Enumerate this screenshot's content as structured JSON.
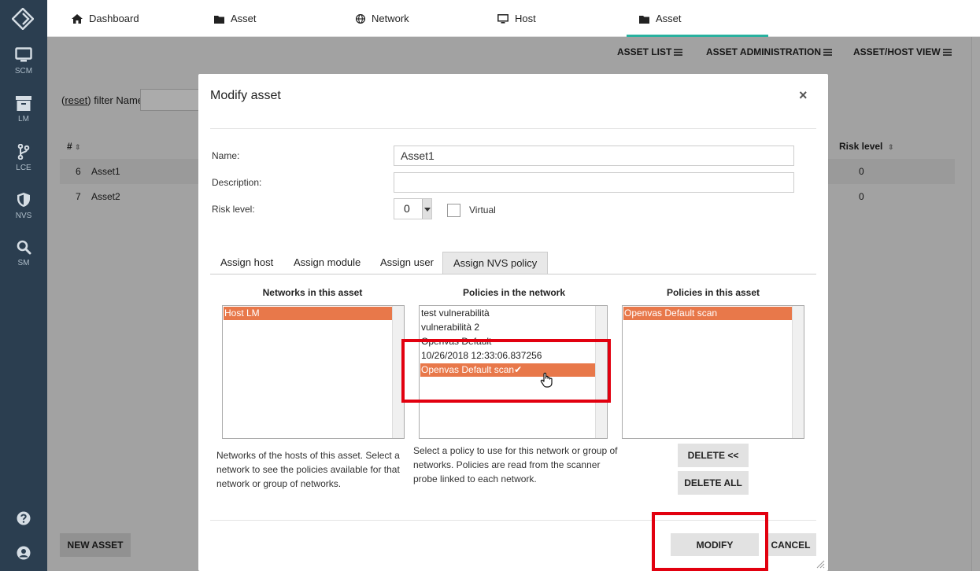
{
  "sidebar": {
    "logo_icon": "diamond-logo-icon",
    "items": [
      {
        "label": "SCM",
        "icon": "monitor-icon"
      },
      {
        "label": "LM",
        "icon": "archive-icon"
      },
      {
        "label": "LCE",
        "icon": "branch-icon"
      },
      {
        "label": "NVS",
        "icon": "shield-icon"
      },
      {
        "label": "SM",
        "icon": "search-icon"
      }
    ],
    "bottom_icons": [
      "help-icon",
      "user-icon"
    ]
  },
  "topbar": {
    "tabs": [
      {
        "label": "Dashboard",
        "icon": "home-icon"
      },
      {
        "label": "Asset",
        "icon": "folder-icon"
      },
      {
        "label": "Network",
        "icon": "globe-icon"
      },
      {
        "label": "Host",
        "icon": "desktop-icon"
      },
      {
        "label": "Asset",
        "icon": "folder-icon",
        "active": true
      }
    ],
    "active_color": "#29b19f"
  },
  "page": {
    "subnav": [
      "ASSET LIST",
      "ASSET ADMINISTRATION",
      "ASSET/HOST VIEW"
    ],
    "filter": {
      "reset_label": "reset",
      "text": ") filter Name"
    },
    "columns": {
      "id": "#",
      "risk": "Risk level"
    },
    "rows": [
      {
        "id": "6",
        "name": "Asset1",
        "risk": "0"
      },
      {
        "id": "7",
        "name": "Asset2",
        "risk": "0"
      }
    ],
    "new_asset_label": "NEW ASSET"
  },
  "modal": {
    "title": "Modify asset",
    "close_glyph": "×",
    "fields": {
      "name_label": "Name:",
      "name_value": "Asset1",
      "description_label": "Description:",
      "description_value": "",
      "risk_label": "Risk level:",
      "risk_value": "0",
      "virtual_label": "Virtual",
      "virtual_checked": false
    },
    "tabs": [
      "Assign host",
      "Assign module",
      "Assign user",
      "Assign NVS policy"
    ],
    "active_tab": "Assign NVS policy",
    "networks": {
      "title": "Networks in this asset",
      "items": [
        "Host LM"
      ],
      "selected": "Host LM",
      "help": "Networks of the hosts of this asset. Select a network to see the policies available for that network or group of networks."
    },
    "policies_network": {
      "title": "Policies in the network",
      "items": [
        "test vulnerabilità",
        "vulnerabilità 2",
        "Openvas Default",
        "10/26/2018 12:33:06.837256",
        "Openvas Default scan"
      ],
      "selected": "Openvas Default scan",
      "check_glyph": "✔",
      "help": "Select a policy to use for this network or group of networks. Policies are read from the scanner probe linked to each network."
    },
    "policies_asset": {
      "title": "Policies in this asset",
      "items": [
        "Openvas Default scan"
      ],
      "selected": "Openvas Default scan"
    },
    "buttons": {
      "delete_one": "DELETE <<",
      "delete_all": "DELETE ALL",
      "modify": "MODIFY",
      "cancel": "CANCEL"
    },
    "selection_color": "#e8784a",
    "highlight_color": "#e2000f"
  }
}
